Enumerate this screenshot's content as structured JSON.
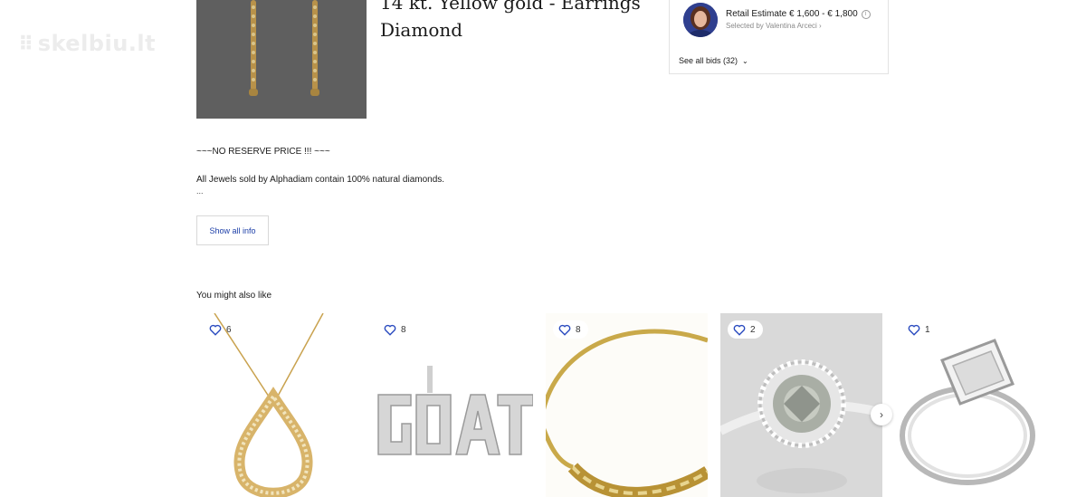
{
  "watermark": {
    "dots": "⠿",
    "text": "skelbiu.lt"
  },
  "lot": {
    "title_line1": "14 kt. Yellow gold - Earrings",
    "title_line2": "Diamond"
  },
  "bid_card": {
    "estimate_label": "Retail Estimate € 1,600 - € 1,800",
    "info_icon": "i",
    "selected_by": "Selected by Valentina Arceci ›",
    "see_all_bids": "See all bids (32)",
    "chevron": "⌄"
  },
  "description": {
    "line1": "~~~NO RESERVE PRICE !!! ~~~",
    "line2": "All Jewels sold by Alphadiam contain 100% natural diamonds.",
    "ellipsis": "..."
  },
  "show_all_info": "Show all info",
  "recommendations": {
    "heading": "You might also like",
    "items": [
      {
        "favorites": "6"
      },
      {
        "favorites": "8"
      },
      {
        "favorites": "8"
      },
      {
        "favorites": "2"
      },
      {
        "favorites": "1"
      }
    ],
    "next_arrow": "›"
  },
  "colors": {
    "link_blue": "#1d3fa8",
    "heart_blue": "#2a4bbf",
    "avatar_bg": "#2f3f8f"
  }
}
